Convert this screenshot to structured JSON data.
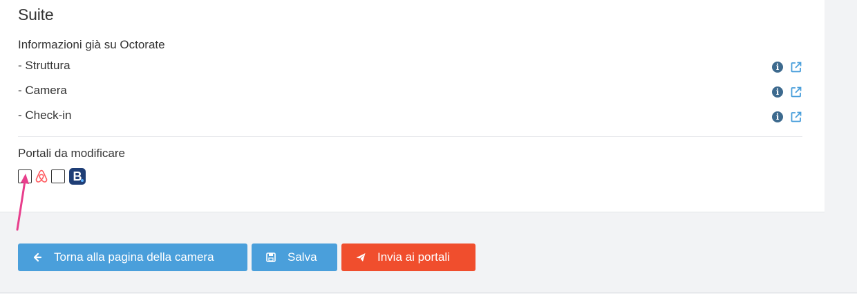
{
  "card": {
    "title": "Suite",
    "info_heading": "Informazioni già su Octorate",
    "rows": [
      {
        "label": "- Struttura"
      },
      {
        "label": "- Camera"
      },
      {
        "label": "- Check-in"
      }
    ],
    "portals_heading": "Portali da modificare",
    "portals": [
      {
        "name": "airbnb",
        "icon": "airbnb-logo-icon",
        "checked": false
      },
      {
        "name": "booking",
        "icon": "booking-logo-icon",
        "checked": false,
        "logo_letter": "B"
      }
    ]
  },
  "actions": {
    "back_label": "Torna alla pagina della camera",
    "save_label": "Salva",
    "send_label": "Invia ai portali"
  },
  "colors": {
    "primary": "#4a9fdb",
    "danger": "#f04e2d",
    "info_icon": "#3d6a8e",
    "airbnb": "#ff5a5f",
    "booking": "#1f3e76",
    "annotation_arrow": "#e83e8c"
  }
}
